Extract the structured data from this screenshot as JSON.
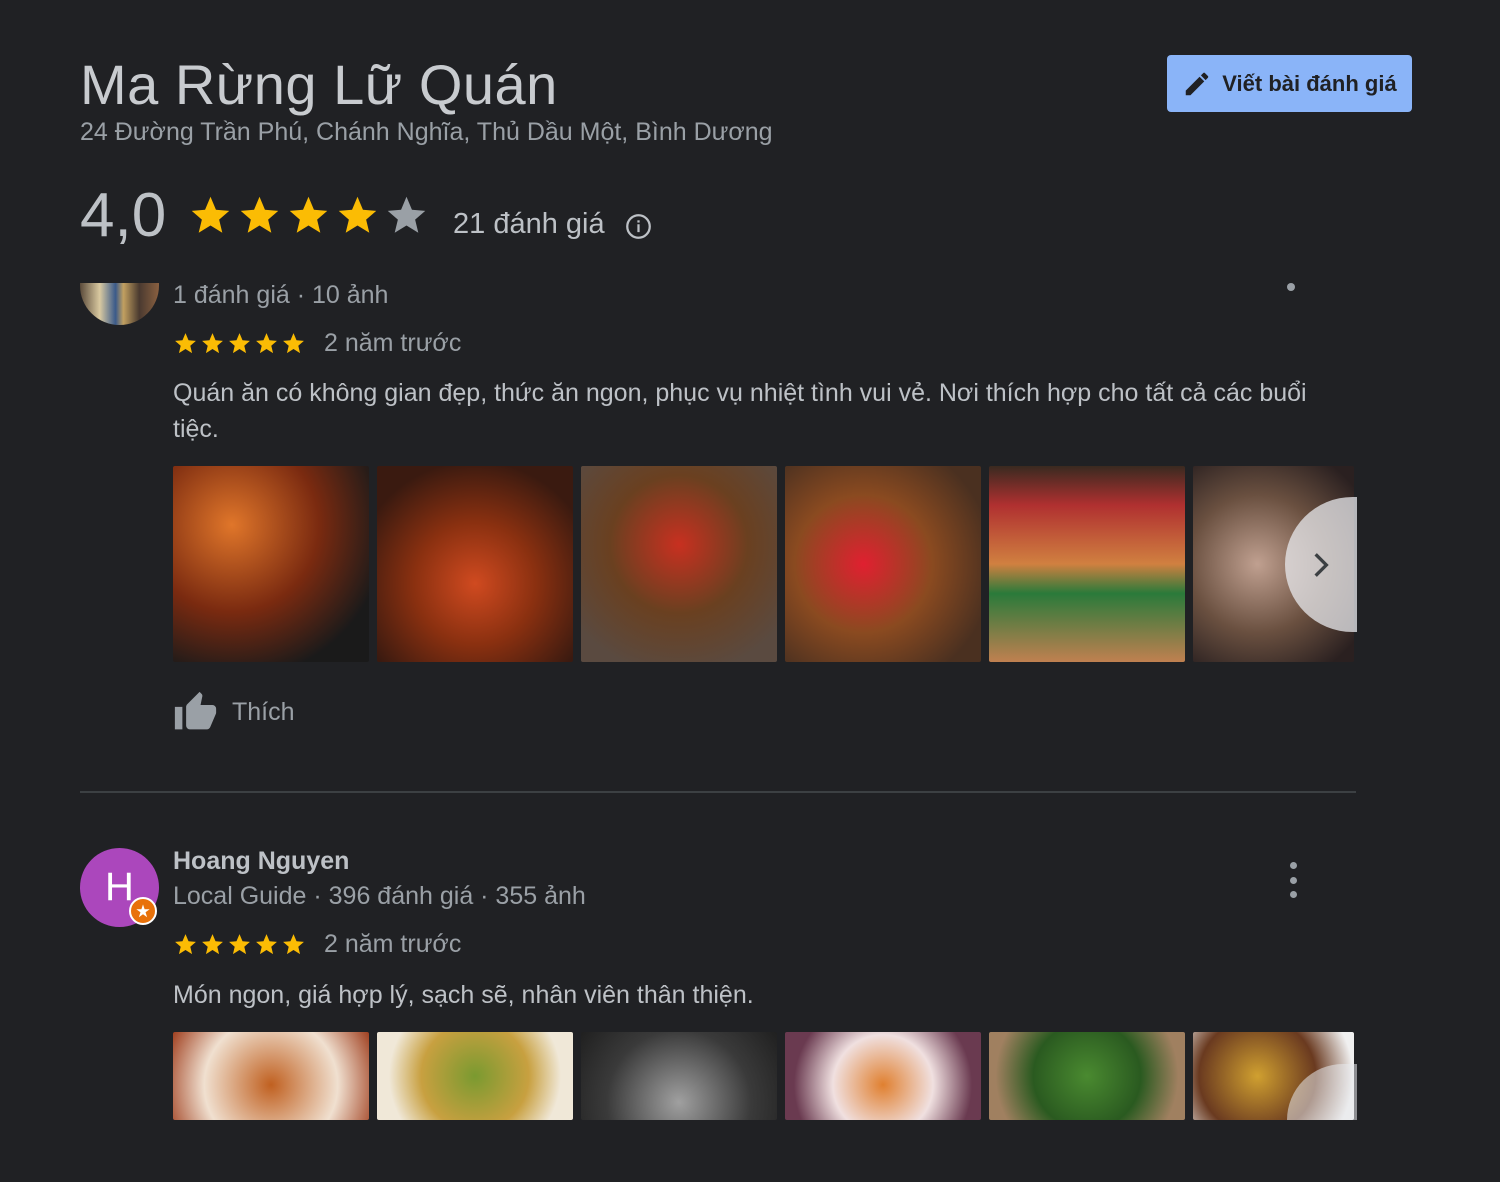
{
  "place": {
    "title": "Ma Rừng Lữ Quán",
    "address": "24 Đường Trần Phú, Chánh Nghĩa, Thủ Dầu Một, Bình Dương",
    "rating": "4,0",
    "rating_value": 4.0,
    "review_count": "21 đánh giá"
  },
  "write_review_button": "Viết bài đánh giá",
  "colors": {
    "star_filled": "#fbbc04",
    "star_empty": "#9aa0a6",
    "accent": "#8ab4f8",
    "background": "#202124"
  },
  "reviews": [
    {
      "reviewer_meta": "1 đánh giá · 10 ảnh",
      "stars": 5,
      "time": "2 năm trước",
      "text": "Quán ăn có không gian đẹp, thức ăn ngon, phục vụ nhiệt tình vui vẻ. Nơi thích hợp cho tất cả các buổi tiệc.",
      "like_label": "Thích"
    },
    {
      "reviewer_name": "Hoang Nguyen",
      "reviewer_initial": "H",
      "reviewer_meta": "Local Guide · 396 đánh giá · 355 ảnh",
      "stars": 5,
      "time": "2 năm trước",
      "text": "Món ngon, giá hợp lý, sạch sẽ, nhân viên thân thiện."
    }
  ],
  "icons": [
    "edit-icon",
    "star-icon",
    "info-icon",
    "chevron-right-icon",
    "thumbs-up-icon",
    "more-vert-icon",
    "local-guide-icon"
  ]
}
